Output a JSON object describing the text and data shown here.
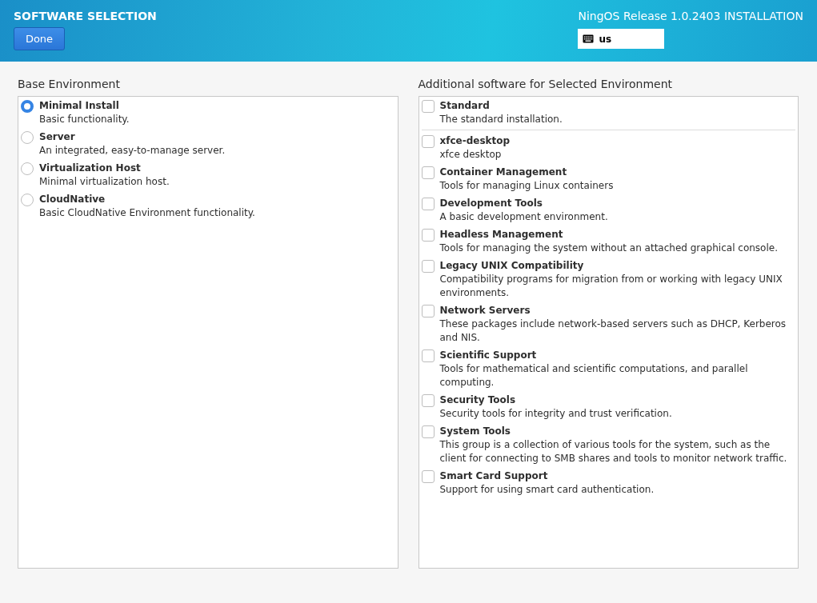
{
  "header": {
    "title": "SOFTWARE SELECTION",
    "done_button": "Done",
    "product": "NingOS Release 1.0.2403 INSTALLATION",
    "keyboard_layout": "us"
  },
  "base_environment": {
    "heading": "Base Environment",
    "options": [
      {
        "name": "Minimal Install",
        "description": "Basic functionality.",
        "selected": true
      },
      {
        "name": "Server",
        "description": "An integrated, easy-to-manage server.",
        "selected": false
      },
      {
        "name": "Virtualization Host",
        "description": "Minimal virtualization host.",
        "selected": false
      },
      {
        "name": "CloudNative",
        "description": "Basic CloudNative Environment functionality.",
        "selected": false
      }
    ]
  },
  "additional_software": {
    "heading": "Additional software for Selected Environment",
    "environment_addons": [
      {
        "name": "Standard",
        "description": "The standard installation.",
        "checked": false
      }
    ],
    "other_addons": [
      {
        "name": "xfce-desktop",
        "description": "xfce desktop",
        "checked": false
      },
      {
        "name": "Container Management",
        "description": "Tools for managing Linux containers",
        "checked": false
      },
      {
        "name": "Development Tools",
        "description": "A basic development environment.",
        "checked": false
      },
      {
        "name": "Headless Management",
        "description": "Tools for managing the system without an attached graphical console.",
        "checked": false
      },
      {
        "name": "Legacy UNIX Compatibility",
        "description": "Compatibility programs for migration from or working with legacy UNIX environments.",
        "checked": false
      },
      {
        "name": "Network Servers",
        "description": "These packages include network-based servers such as DHCP, Kerberos and NIS.",
        "checked": false
      },
      {
        "name": "Scientific Support",
        "description": "Tools for mathematical and scientific computations, and parallel computing.",
        "checked": false
      },
      {
        "name": "Security Tools",
        "description": "Security tools for integrity and trust verification.",
        "checked": false
      },
      {
        "name": "System Tools",
        "description": "This group is a collection of various tools for the system, such as the client for connecting to SMB shares and tools to monitor network traffic.",
        "checked": false
      },
      {
        "name": "Smart Card Support",
        "description": "Support for using smart card authentication.",
        "checked": false
      }
    ]
  }
}
